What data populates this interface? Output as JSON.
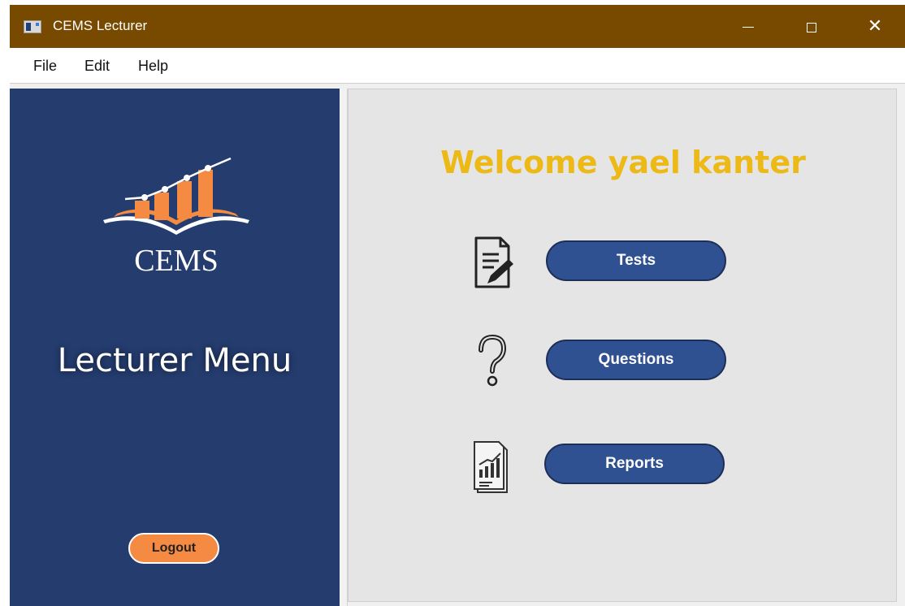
{
  "window": {
    "title": "CEMS Lecturer",
    "minimize_icon": "minimize-icon",
    "maximize_icon": "maximize-icon",
    "close_icon": "close-icon",
    "close_glyph": "✕"
  },
  "menu": {
    "items": [
      "File",
      "Edit",
      "Help"
    ]
  },
  "sidebar": {
    "logo_text": "CEMS",
    "title": "Lecturer Menu",
    "logout_label": "Logout",
    "background": "#243c6e"
  },
  "main": {
    "welcome": "Welcome yael kanter",
    "buttons": [
      {
        "label": "Tests",
        "icon": "test-document-icon"
      },
      {
        "label": "Questions",
        "icon": "question-mark-icon"
      },
      {
        "label": "Reports",
        "icon": "report-chart-icon"
      }
    ]
  },
  "colors": {
    "titlebar": "#774a00",
    "accent_orange": "#f58a42",
    "welcome_text": "#ecb917",
    "button_blue": "#2f5191"
  }
}
